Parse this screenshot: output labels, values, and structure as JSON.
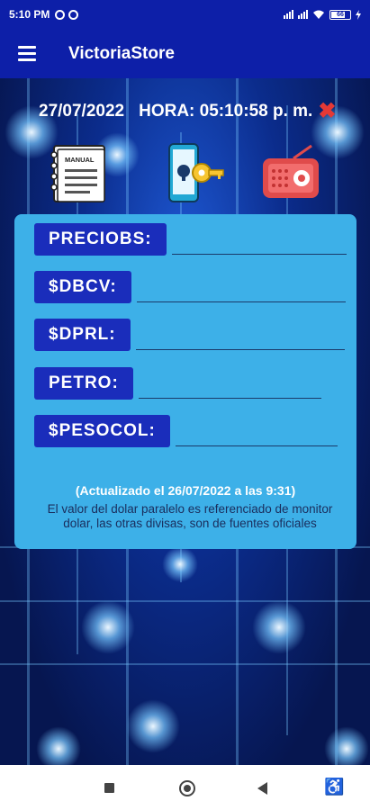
{
  "status_bar": {
    "time": "5:10 PM",
    "battery": "66"
  },
  "app_bar": {
    "title": "VictoriaStore",
    "menu_icon": "hamburger-menu-icon"
  },
  "header": {
    "date": "27/07/2022",
    "time_label": "HORA: 05:10:58 p. m.",
    "close_icon": "close-x-icon"
  },
  "icon_buttons": [
    {
      "name": "manual-icon",
      "text": "MANUAL"
    },
    {
      "name": "phone-key-icon"
    },
    {
      "name": "radio-icon"
    }
  ],
  "rates": [
    {
      "label": "PRECIOBS:",
      "value": ""
    },
    {
      "label": "$DBCV:",
      "value": ""
    },
    {
      "label": "$DPRL:",
      "value": ""
    },
    {
      "label": "PETRO:",
      "value": ""
    },
    {
      "label": "$PESOCOL:",
      "value": ""
    }
  ],
  "updated_text": "(Actualizado el 26/07/2022 a las 9:31)",
  "note_text": "El valor del dolar paralelo es referenciado de monitor dolar, las otras divisas, son de fuentes oficiales",
  "colors": {
    "primary": "#0d1fa8",
    "card": "#3db0e8",
    "label_bg": "#1a2dbb",
    "close": "#e53935"
  }
}
